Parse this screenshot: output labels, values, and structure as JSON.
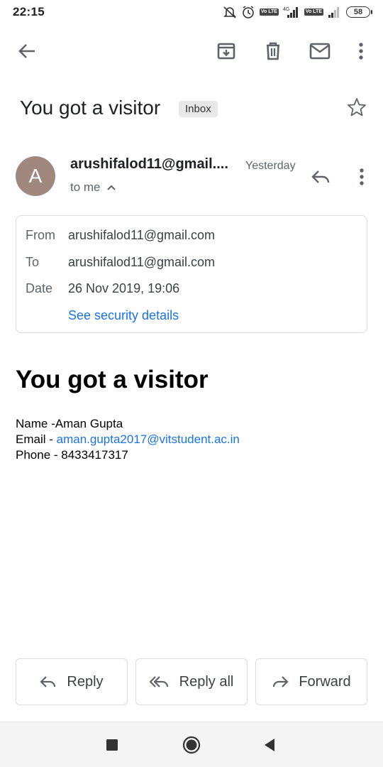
{
  "status_bar": {
    "time": "22:15",
    "network_label": "4G",
    "lte_label": "Vo LTE",
    "battery": "58"
  },
  "toolbar": {
    "back": "back",
    "archive": "archive",
    "delete": "delete",
    "mark_unread": "mark unread",
    "more": "more"
  },
  "email": {
    "subject": "You got a visitor",
    "label": "Inbox",
    "avatar_letter": "A",
    "avatar_color": "#a1887f",
    "sender": "arushifalod11@gmail....",
    "date_short": "Yesterday",
    "to_me": "to me",
    "details": {
      "from_label": "From",
      "from_value": "arushifalod11@gmail.com",
      "to_label": "To",
      "to_value": "arushifalod11@gmail.com",
      "date_label": "Date",
      "date_value": "26 Nov 2019, 19:06",
      "security_link": "See security details"
    },
    "body": {
      "heading": "You got a visitor",
      "name_line": "Name -Aman Gupta",
      "email_prefix": "Email - ",
      "email_link": "aman.gupta2017@vitstudent.ac.in",
      "phone_line": "Phone - 8433417317"
    }
  },
  "actions": {
    "reply": "Reply",
    "reply_all": "Reply all",
    "forward": "Forward"
  },
  "colors": {
    "link": "#1a73e8",
    "icon": "#5f6368",
    "border": "#dadce0"
  }
}
